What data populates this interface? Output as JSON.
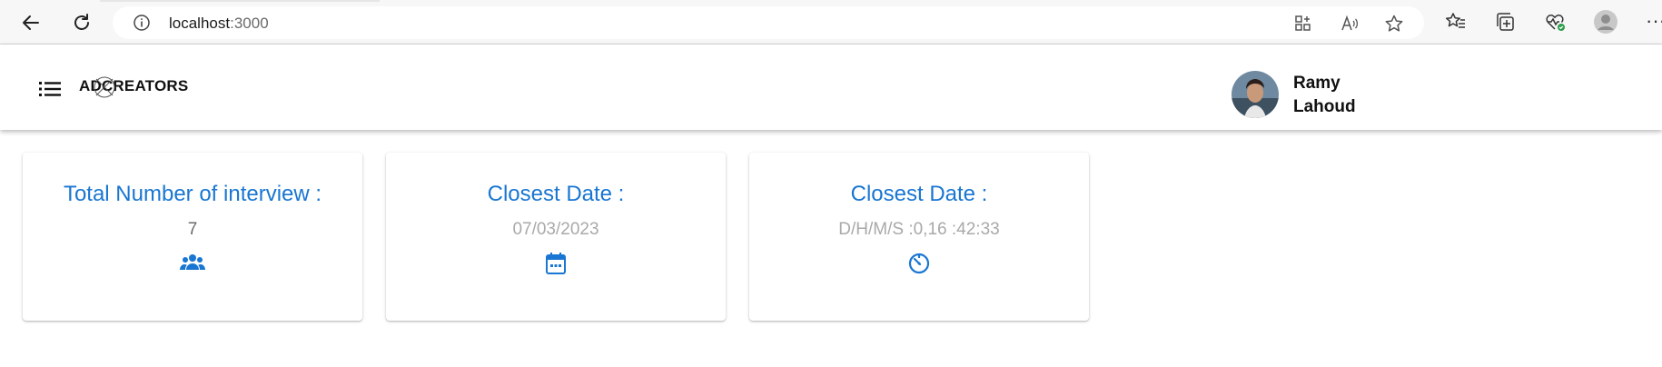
{
  "browser": {
    "url_host": "localhost",
    "url_port": ":3000",
    "icons": [
      "back-icon",
      "refresh-icon",
      "info-icon",
      "app-available-icon",
      "read-aloud-icon",
      "favorite-star-icon",
      "favorites-icon",
      "collections-icon",
      "browser-essentials-icon",
      "profile-icon",
      "more-icon"
    ],
    "more_label": "···"
  },
  "header": {
    "logo_text": "ADCREATORS",
    "user_first": "Ramy",
    "user_last": "Lahoud",
    "icons": [
      "menu-icon",
      "avatar"
    ]
  },
  "cards": [
    {
      "title": "Total Number of interview :",
      "value": "7",
      "icon": "group-icon"
    },
    {
      "title": "Closest Date :",
      "value": "07/03/2023",
      "icon": "calendar-icon"
    },
    {
      "title": "Closest Date :",
      "value": "D/H/M/S :0,16 :42:33",
      "icon": "timer-icon"
    }
  ],
  "colors": {
    "accent": "#1976d2",
    "value_dark": "#6b6b6b",
    "value_light": "#a9a9a9"
  }
}
